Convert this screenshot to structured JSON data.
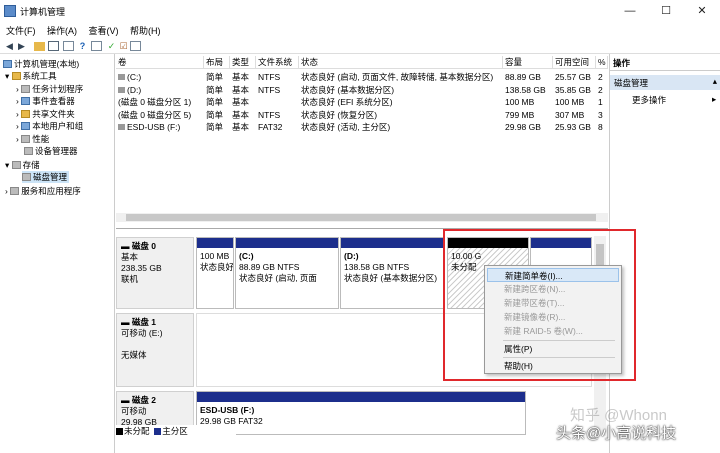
{
  "window": {
    "title": "计算机管理",
    "minimize": "—",
    "maximize": "☐",
    "close": "✕"
  },
  "menu": [
    "文件(F)",
    "操作(A)",
    "查看(V)",
    "帮助(H)"
  ],
  "tree": {
    "root": "计算机管理(本地)",
    "system_tools": "系统工具",
    "task_scheduler": "任务计划程序",
    "event_viewer": "事件查看器",
    "shared_folders": "共享文件夹",
    "local_users": "本地用户和组",
    "performance": "性能",
    "device_manager": "设备管理器",
    "storage": "存储",
    "disk_management": "磁盘管理",
    "services_apps": "服务和应用程序"
  },
  "volume_table": {
    "headers": [
      "卷",
      "布局",
      "类型",
      "文件系统",
      "状态",
      "容量",
      "可用空间",
      "%"
    ],
    "rows": [
      [
        "(C:)",
        "简单",
        "基本",
        "NTFS",
        "状态良好 (启动, 页面文件, 故障转储, 基本数据分区)",
        "88.89 GB",
        "25.57 GB",
        "2"
      ],
      [
        "(D:)",
        "简单",
        "基本",
        "NTFS",
        "状态良好 (基本数据分区)",
        "138.58 GB",
        "35.85 GB",
        "2"
      ],
      [
        "(磁盘 0 磁盘分区 1)",
        "简单",
        "基本",
        "",
        "状态良好 (EFI 系统分区)",
        "100 MB",
        "100 MB",
        "1"
      ],
      [
        "(磁盘 0 磁盘分区 5)",
        "简单",
        "基本",
        "NTFS",
        "状态良好 (恢复分区)",
        "799 MB",
        "307 MB",
        "3"
      ],
      [
        "ESD-USB (F:)",
        "简单",
        "基本",
        "FAT32",
        "状态良好 (活动, 主分区)",
        "29.98 GB",
        "25.93 GB",
        "8"
      ]
    ]
  },
  "disks": {
    "disk0": {
      "name": "磁盘 0",
      "type": "基本",
      "size": "238.35 GB",
      "status": "联机",
      "partitions": [
        {
          "line1": "100 MB",
          "line2": "状态良好"
        },
        {
          "line1": "(C:)",
          "line2": "88.89 GB NTFS",
          "line3": "状态良好 (启动, 页面"
        },
        {
          "line1": "(D:)",
          "line2": "138.58 GB NTFS",
          "line3": "状态良好 (基本数据分区)"
        },
        {
          "line1": "10.00 G",
          "line2": "未分配"
        }
      ]
    },
    "disk1": {
      "name": "磁盘 1",
      "type": "可移动 (E:)",
      "status": "无媒体"
    },
    "disk2": {
      "name": "磁盘 2",
      "type": "可移动",
      "size": "29.98 GB",
      "partition": "ESD-USB  (F:)",
      "partition_size": "29.98 GB FAT32"
    }
  },
  "legend": {
    "unallocated": "未分配",
    "primary": "主分区",
    "unallocated_color": "#000000",
    "primary_color": "#1c2e8c"
  },
  "actions": {
    "header": "操作",
    "section": "磁盘管理",
    "more": "更多操作"
  },
  "context_menu": {
    "items": [
      "新建简单卷(I)...",
      "新建跨区卷(N)...",
      "新建带区卷(T)...",
      "新建镜像卷(R)...",
      "新建 RAID-5 卷(W)..."
    ],
    "properties": "属性(P)",
    "help": "帮助(H)"
  },
  "watermark": {
    "source": "头条@小高说科技",
    "zhihu": "知乎 @Whonn"
  }
}
